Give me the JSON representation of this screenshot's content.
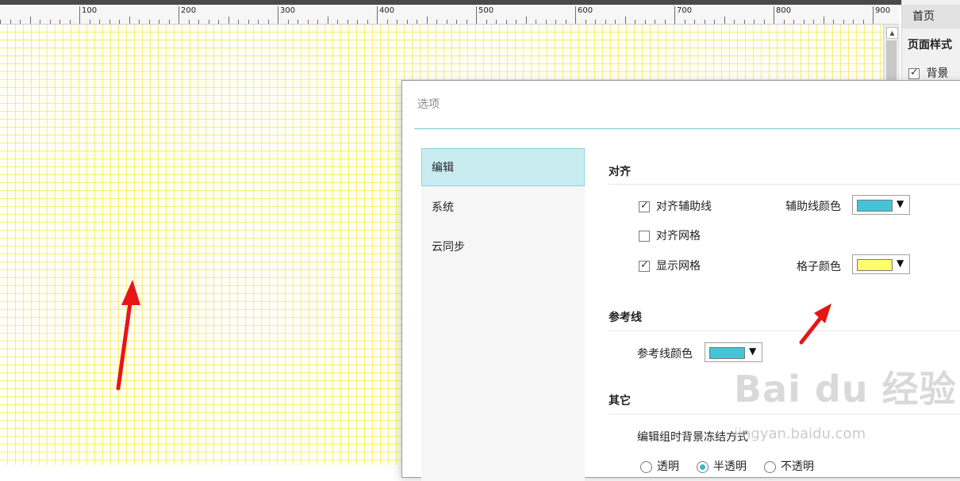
{
  "ruler": {
    "labels": [
      "100",
      "200",
      "300",
      "400",
      "500",
      "600",
      "700",
      "800",
      "900"
    ]
  },
  "right_panel": {
    "home_tab": "首页",
    "page_style_heading": "页面样式",
    "background_label": "背景",
    "background_checked": true
  },
  "dialog": {
    "title": "选项",
    "nav": [
      {
        "label": "编辑",
        "active": true
      },
      {
        "label": "系统",
        "active": false
      },
      {
        "label": "云同步",
        "active": false
      }
    ],
    "align": {
      "heading": "对齐",
      "snap_guides": {
        "label": "对齐辅助线",
        "checked": true
      },
      "snap_grid": {
        "label": "对齐网格",
        "checked": false
      },
      "show_grid": {
        "label": "显示网格",
        "checked": true
      },
      "guide_color_label": "辅助线颜色",
      "guide_color": "#45c4d6",
      "grid_color_label": "格子颜色",
      "grid_color": "#ffff6e"
    },
    "reference": {
      "heading": "参考线",
      "color_label": "参考线颜色",
      "color": "#45c4d6"
    },
    "other": {
      "heading": "其它",
      "freeze_label": "编辑组时背景冻结方式",
      "options": [
        "透明",
        "半透明",
        "不透明"
      ],
      "selected": "半透明"
    }
  },
  "colors": {
    "grid_line": "#f4e850",
    "accent": "#39b7cb",
    "annotation_arrow": "#e81515"
  },
  "watermark": {
    "brand": "Bai du 经验",
    "url": "jingyan.baidu.com"
  }
}
